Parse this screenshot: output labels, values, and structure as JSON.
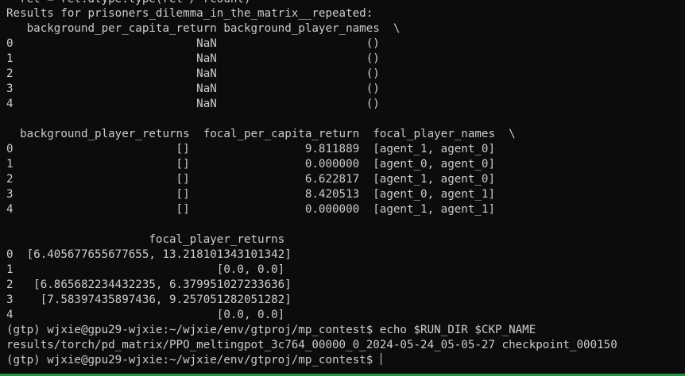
{
  "terminal": {
    "lines": [
      "  ret = ret.dtype.type(ret / rcount)",
      "Results for prisoners_dilemma_in_the_matrix__repeated:",
      "   background_per_capita_return background_player_names  \\",
      "0                           NaN                      ()",
      "1                           NaN                      ()",
      "2                           NaN                      ()",
      "3                           NaN                      ()",
      "4                           NaN                      ()",
      "",
      "  background_player_returns  focal_per_capita_return  focal_player_names  \\",
      "0                        []                 9.811889  [agent_1, agent_0]",
      "1                        []                 0.000000  [agent_0, agent_0]",
      "2                        []                 6.622817  [agent_1, agent_0]",
      "3                        []                 8.420513  [agent_0, agent_1]",
      "4                        []                 0.000000  [agent_1, agent_1]",
      "",
      "                     focal_player_returns",
      "0  [6.405677655677655, 13.218101343101342]",
      "1                              [0.0, 0.0]",
      "2   [6.865682234432235, 6.379951027233636]",
      "3    [7.58397435897436, 9.257051282051282]",
      "4                              [0.0, 0.0]",
      "(gtp) wjxie@gpu29-wjxie:~/wjxie/env/gtproj/mp_contest$ echo $RUN_DIR $CKP_NAME",
      "results/torch/pd_matrix/PPO_meltingpot_3c764_00000_0_2024-05-24_05-05-27 checkpoint_000150"
    ],
    "prompt": "(gtp) wjxie@gpu29-wjxie:~/wjxie/env/gtproj/mp_contest$ "
  },
  "colors": {
    "background": "#0c0c0c",
    "text": "#cccccc",
    "status_strip": "#2c8c44"
  }
}
